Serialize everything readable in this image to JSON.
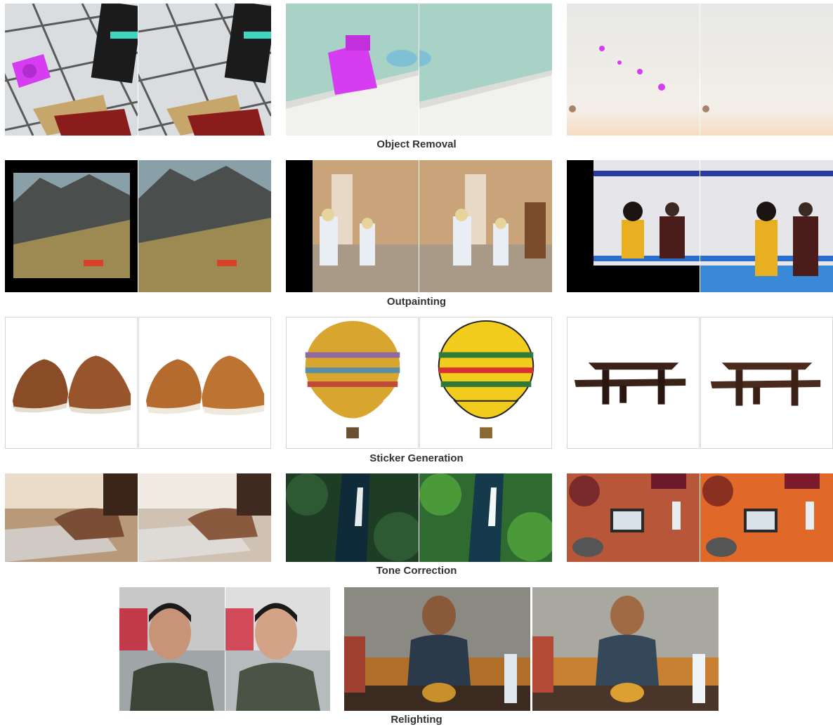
{
  "captions": {
    "object_removal": "Object Removal",
    "outpainting": "Outpainting",
    "sticker_generation": "Sticker Generation",
    "tone_correction": "Tone Correction",
    "relighting": "Relighting"
  },
  "colors": {
    "mask_magenta": "#d63cf0",
    "caption_text": "#333333",
    "panel_border": "#d6d6d6"
  }
}
